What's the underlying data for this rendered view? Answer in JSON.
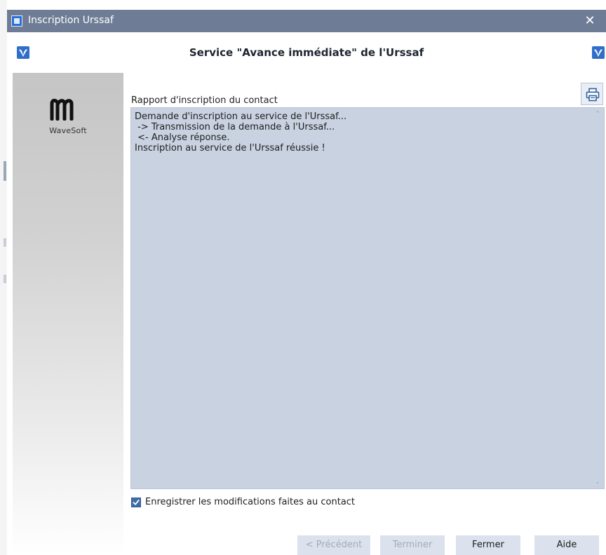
{
  "window": {
    "title": "Inscription Urssaf",
    "close_glyph": "✕"
  },
  "header": {
    "heading": "Service \"Avance immédiate\" de l'Urssaf"
  },
  "sidebar": {
    "brand_name": "WaveSoft"
  },
  "report": {
    "label": "Rapport d'inscription du contact",
    "lines": [
      "Demande d'inscription au service de l'Urssaf...",
      " -> Transmission de la demande à l'Urssaf...",
      " <- Analyse réponse.",
      "Inscription au service de l'Urssaf réussie !"
    ]
  },
  "options": {
    "save_changes_label": "Enregistrer les modifications faites au contact",
    "save_changes_checked": true
  },
  "buttons": {
    "previous": "< Précédent",
    "finish": "Terminer",
    "close": "Fermer",
    "help": "Aide"
  },
  "icons": {
    "app": "app-icon",
    "close": "close-icon",
    "brand": "wavesoft-logo-icon",
    "print": "printer-icon",
    "checkmark": "checkmark-icon"
  },
  "colors": {
    "titlebar": "#6e7d95",
    "report_background": "#c9d2e1",
    "button_background": "#dbe2ed",
    "checkbox": "#3f6da8"
  }
}
